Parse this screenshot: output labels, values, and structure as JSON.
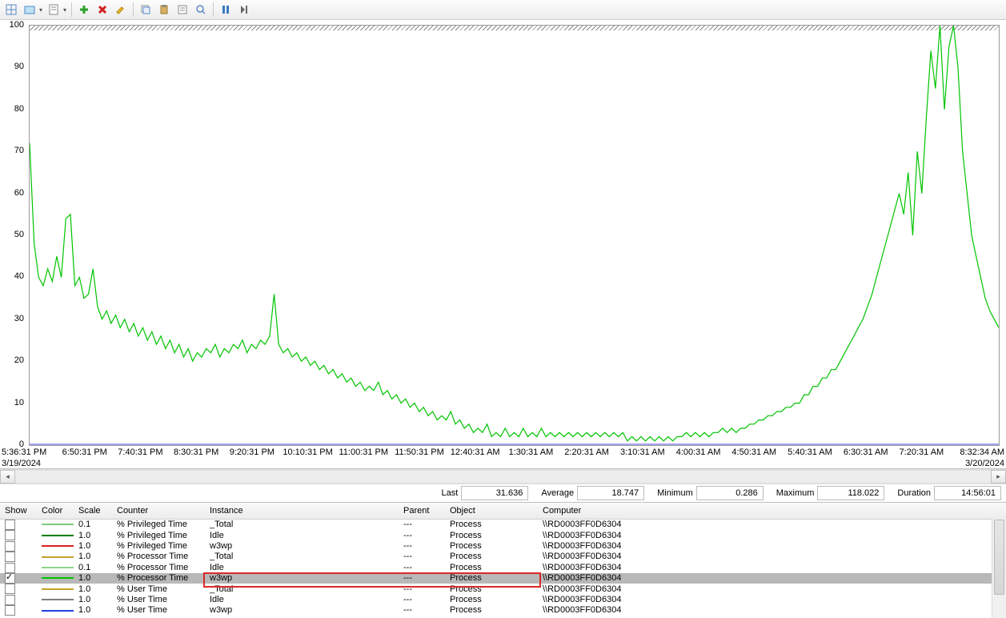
{
  "toolbar_icons": [
    "grid-icon",
    "view-icon",
    "report-icon",
    "add-icon",
    "delete-icon",
    "highlight-icon",
    "copy-icon",
    "paste-icon",
    "properties-icon",
    "zoom-icon",
    "freeze-icon",
    "update-icon"
  ],
  "stats": {
    "last_label": "Last",
    "last_value": "31.636",
    "avg_label": "Average",
    "avg_value": "18.747",
    "min_label": "Minimum",
    "min_value": "0.286",
    "max_label": "Maximum",
    "max_value": "118.022",
    "dur_label": "Duration",
    "dur_value": "14:56:01"
  },
  "xaxis": {
    "start_time": "5:36:31 PM",
    "start_date": "3/19/2024",
    "end_time": "8:32:34 AM",
    "end_date": "3/20/2024",
    "ticks": [
      "6:50:31 PM",
      "7:40:31 PM",
      "8:30:31 PM",
      "9:20:31 PM",
      "10:10:31 PM",
      "11:00:31 PM",
      "11:50:31 PM",
      "12:40:31 AM",
      "1:30:31 AM",
      "2:20:31 AM",
      "3:10:31 AM",
      "4:00:31 AM",
      "4:50:31 AM",
      "5:40:31 AM",
      "6:30:31 AM",
      "7:20:31 AM"
    ]
  },
  "yaxis": {
    "ticks": [
      "0",
      "10",
      "20",
      "30",
      "40",
      "50",
      "60",
      "70",
      "80",
      "90",
      "100"
    ]
  },
  "columns": {
    "show": "Show",
    "color": "Color",
    "scale": "Scale",
    "counter": "Counter",
    "instance": "Instance",
    "parent": "Parent",
    "object": "Object",
    "computer": "Computer"
  },
  "rows": [
    {
      "show": false,
      "color": "#7fc97f",
      "scale": "0.1",
      "counter": "% Privileged Time",
      "instance": "_Total",
      "parent": "---",
      "object": "Process",
      "computer": "\\\\RD0003FF0D6304"
    },
    {
      "show": false,
      "color": "#008000",
      "scale": "1.0",
      "counter": "% Privileged Time",
      "instance": "Idle",
      "parent": "---",
      "object": "Process",
      "computer": "\\\\RD0003FF0D6304"
    },
    {
      "show": false,
      "color": "#e02020",
      "scale": "1.0",
      "counter": "% Privileged Time",
      "instance": "w3wp",
      "parent": "---",
      "object": "Process",
      "computer": "\\\\RD0003FF0D6304"
    },
    {
      "show": false,
      "color": "#c9a227",
      "scale": "1.0",
      "counter": "% Processor Time",
      "instance": "_Total",
      "parent": "---",
      "object": "Process",
      "computer": "\\\\RD0003FF0D6304"
    },
    {
      "show": false,
      "color": "#8bd48b",
      "scale": "0.1",
      "counter": "% Processor Time",
      "instance": "Idle",
      "parent": "---",
      "object": "Process",
      "computer": "\\\\RD0003FF0D6304"
    },
    {
      "show": true,
      "color": "#00c400",
      "scale": "1.0",
      "counter": "% Processor Time",
      "instance": "w3wp",
      "parent": "---",
      "object": "Process",
      "computer": "\\\\RD0003FF0D6304",
      "selected": true
    },
    {
      "show": false,
      "color": "#c9a227",
      "scale": "1.0",
      "counter": "% User Time",
      "instance": "_Total",
      "parent": "---",
      "object": "Process",
      "computer": "\\\\RD0003FF0D6304"
    },
    {
      "show": false,
      "color": "#7f7f7f",
      "scale": "1.0",
      "counter": "% User Time",
      "instance": "Idle",
      "parent": "---",
      "object": "Process",
      "computer": "\\\\RD0003FF0D6304"
    },
    {
      "show": false,
      "color": "#2040e0",
      "scale": "1.0",
      "counter": "% User Time",
      "instance": "w3wp",
      "parent": "---",
      "object": "Process",
      "computer": "\\\\RD0003FF0D6304"
    }
  ],
  "chart_data": {
    "type": "line",
    "title": "",
    "xlabel": "",
    "ylabel": "",
    "ylim": [
      0,
      100
    ],
    "x_range_minutes": [
      0,
      896
    ],
    "series": [
      {
        "name": "% Processor Time (w3wp)",
        "color": "#00c400",
        "values": [
          72,
          48,
          40,
          38,
          42,
          39,
          45,
          40,
          54,
          55,
          38,
          40,
          35,
          36,
          42,
          33,
          30,
          32,
          29,
          31,
          28,
          30,
          27,
          29,
          26,
          28,
          25,
          27,
          24,
          26,
          23,
          25,
          22,
          24,
          21,
          23,
          20,
          22,
          21,
          23,
          22,
          24,
          21,
          23,
          22,
          24,
          23,
          25,
          22,
          24,
          23,
          25,
          24,
          26,
          36,
          24,
          22,
          23,
          21,
          22,
          20,
          21,
          19,
          20,
          18,
          19,
          17,
          18,
          16,
          17,
          15,
          16,
          14,
          15,
          13,
          14,
          13,
          15,
          12,
          13,
          11,
          12,
          10,
          11,
          9,
          10,
          8,
          9,
          7,
          8,
          6,
          7,
          6,
          8,
          5,
          6,
          4,
          5,
          3,
          4,
          3,
          5,
          2,
          3,
          2,
          4,
          2,
          3,
          2,
          4,
          2,
          3,
          2,
          4,
          2,
          3,
          2,
          3,
          2,
          3,
          2,
          3,
          2,
          3,
          2,
          3,
          2,
          3,
          2,
          3,
          2,
          3,
          1,
          2,
          1,
          2,
          1,
          2,
          1,
          2,
          1,
          2,
          1,
          2,
          2,
          3,
          2,
          3,
          2,
          3,
          2,
          3,
          3,
          4,
          3,
          4,
          3,
          4,
          4,
          5,
          5,
          6,
          6,
          7,
          7,
          8,
          8,
          9,
          9,
          10,
          10,
          12,
          12,
          14,
          14,
          16,
          16,
          18,
          18,
          20,
          22,
          24,
          26,
          28,
          30,
          33,
          36,
          40,
          44,
          48,
          52,
          56,
          60,
          55,
          65,
          50,
          70,
          60,
          78,
          94,
          85,
          100,
          80,
          95,
          100,
          90,
          70,
          60,
          50,
          45,
          40,
          35,
          32,
          30,
          28
        ]
      }
    ]
  }
}
